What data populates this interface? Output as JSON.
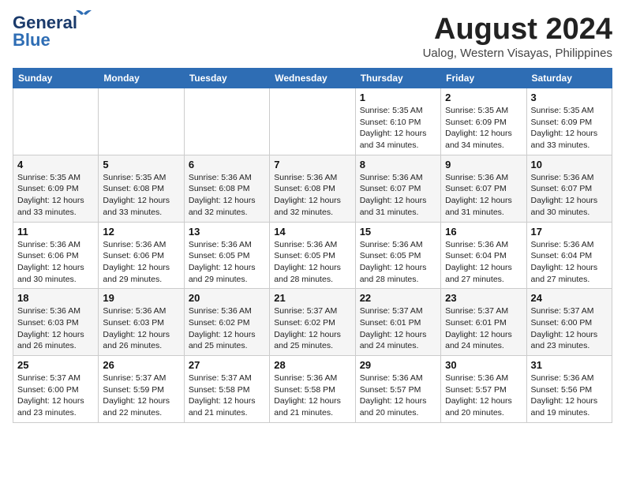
{
  "header": {
    "logo_line1": "General",
    "logo_line2": "Blue",
    "month_year": "August 2024",
    "location": "Ualog, Western Visayas, Philippines"
  },
  "weekdays": [
    "Sunday",
    "Monday",
    "Tuesday",
    "Wednesday",
    "Thursday",
    "Friday",
    "Saturday"
  ],
  "weeks": [
    [
      {
        "day": "",
        "info": ""
      },
      {
        "day": "",
        "info": ""
      },
      {
        "day": "",
        "info": ""
      },
      {
        "day": "",
        "info": ""
      },
      {
        "day": "1",
        "info": "Sunrise: 5:35 AM\nSunset: 6:10 PM\nDaylight: 12 hours\nand 34 minutes."
      },
      {
        "day": "2",
        "info": "Sunrise: 5:35 AM\nSunset: 6:09 PM\nDaylight: 12 hours\nand 34 minutes."
      },
      {
        "day": "3",
        "info": "Sunrise: 5:35 AM\nSunset: 6:09 PM\nDaylight: 12 hours\nand 33 minutes."
      }
    ],
    [
      {
        "day": "4",
        "info": "Sunrise: 5:35 AM\nSunset: 6:09 PM\nDaylight: 12 hours\nand 33 minutes."
      },
      {
        "day": "5",
        "info": "Sunrise: 5:35 AM\nSunset: 6:08 PM\nDaylight: 12 hours\nand 33 minutes."
      },
      {
        "day": "6",
        "info": "Sunrise: 5:36 AM\nSunset: 6:08 PM\nDaylight: 12 hours\nand 32 minutes."
      },
      {
        "day": "7",
        "info": "Sunrise: 5:36 AM\nSunset: 6:08 PM\nDaylight: 12 hours\nand 32 minutes."
      },
      {
        "day": "8",
        "info": "Sunrise: 5:36 AM\nSunset: 6:07 PM\nDaylight: 12 hours\nand 31 minutes."
      },
      {
        "day": "9",
        "info": "Sunrise: 5:36 AM\nSunset: 6:07 PM\nDaylight: 12 hours\nand 31 minutes."
      },
      {
        "day": "10",
        "info": "Sunrise: 5:36 AM\nSunset: 6:07 PM\nDaylight: 12 hours\nand 30 minutes."
      }
    ],
    [
      {
        "day": "11",
        "info": "Sunrise: 5:36 AM\nSunset: 6:06 PM\nDaylight: 12 hours\nand 30 minutes."
      },
      {
        "day": "12",
        "info": "Sunrise: 5:36 AM\nSunset: 6:06 PM\nDaylight: 12 hours\nand 29 minutes."
      },
      {
        "day": "13",
        "info": "Sunrise: 5:36 AM\nSunset: 6:05 PM\nDaylight: 12 hours\nand 29 minutes."
      },
      {
        "day": "14",
        "info": "Sunrise: 5:36 AM\nSunset: 6:05 PM\nDaylight: 12 hours\nand 28 minutes."
      },
      {
        "day": "15",
        "info": "Sunrise: 5:36 AM\nSunset: 6:05 PM\nDaylight: 12 hours\nand 28 minutes."
      },
      {
        "day": "16",
        "info": "Sunrise: 5:36 AM\nSunset: 6:04 PM\nDaylight: 12 hours\nand 27 minutes."
      },
      {
        "day": "17",
        "info": "Sunrise: 5:36 AM\nSunset: 6:04 PM\nDaylight: 12 hours\nand 27 minutes."
      }
    ],
    [
      {
        "day": "18",
        "info": "Sunrise: 5:36 AM\nSunset: 6:03 PM\nDaylight: 12 hours\nand 26 minutes."
      },
      {
        "day": "19",
        "info": "Sunrise: 5:36 AM\nSunset: 6:03 PM\nDaylight: 12 hours\nand 26 minutes."
      },
      {
        "day": "20",
        "info": "Sunrise: 5:36 AM\nSunset: 6:02 PM\nDaylight: 12 hours\nand 25 minutes."
      },
      {
        "day": "21",
        "info": "Sunrise: 5:37 AM\nSunset: 6:02 PM\nDaylight: 12 hours\nand 25 minutes."
      },
      {
        "day": "22",
        "info": "Sunrise: 5:37 AM\nSunset: 6:01 PM\nDaylight: 12 hours\nand 24 minutes."
      },
      {
        "day": "23",
        "info": "Sunrise: 5:37 AM\nSunset: 6:01 PM\nDaylight: 12 hours\nand 24 minutes."
      },
      {
        "day": "24",
        "info": "Sunrise: 5:37 AM\nSunset: 6:00 PM\nDaylight: 12 hours\nand 23 minutes."
      }
    ],
    [
      {
        "day": "25",
        "info": "Sunrise: 5:37 AM\nSunset: 6:00 PM\nDaylight: 12 hours\nand 23 minutes."
      },
      {
        "day": "26",
        "info": "Sunrise: 5:37 AM\nSunset: 5:59 PM\nDaylight: 12 hours\nand 22 minutes."
      },
      {
        "day": "27",
        "info": "Sunrise: 5:37 AM\nSunset: 5:58 PM\nDaylight: 12 hours\nand 21 minutes."
      },
      {
        "day": "28",
        "info": "Sunrise: 5:36 AM\nSunset: 5:58 PM\nDaylight: 12 hours\nand 21 minutes."
      },
      {
        "day": "29",
        "info": "Sunrise: 5:36 AM\nSunset: 5:57 PM\nDaylight: 12 hours\nand 20 minutes."
      },
      {
        "day": "30",
        "info": "Sunrise: 5:36 AM\nSunset: 5:57 PM\nDaylight: 12 hours\nand 20 minutes."
      },
      {
        "day": "31",
        "info": "Sunrise: 5:36 AM\nSunset: 5:56 PM\nDaylight: 12 hours\nand 19 minutes."
      }
    ]
  ]
}
